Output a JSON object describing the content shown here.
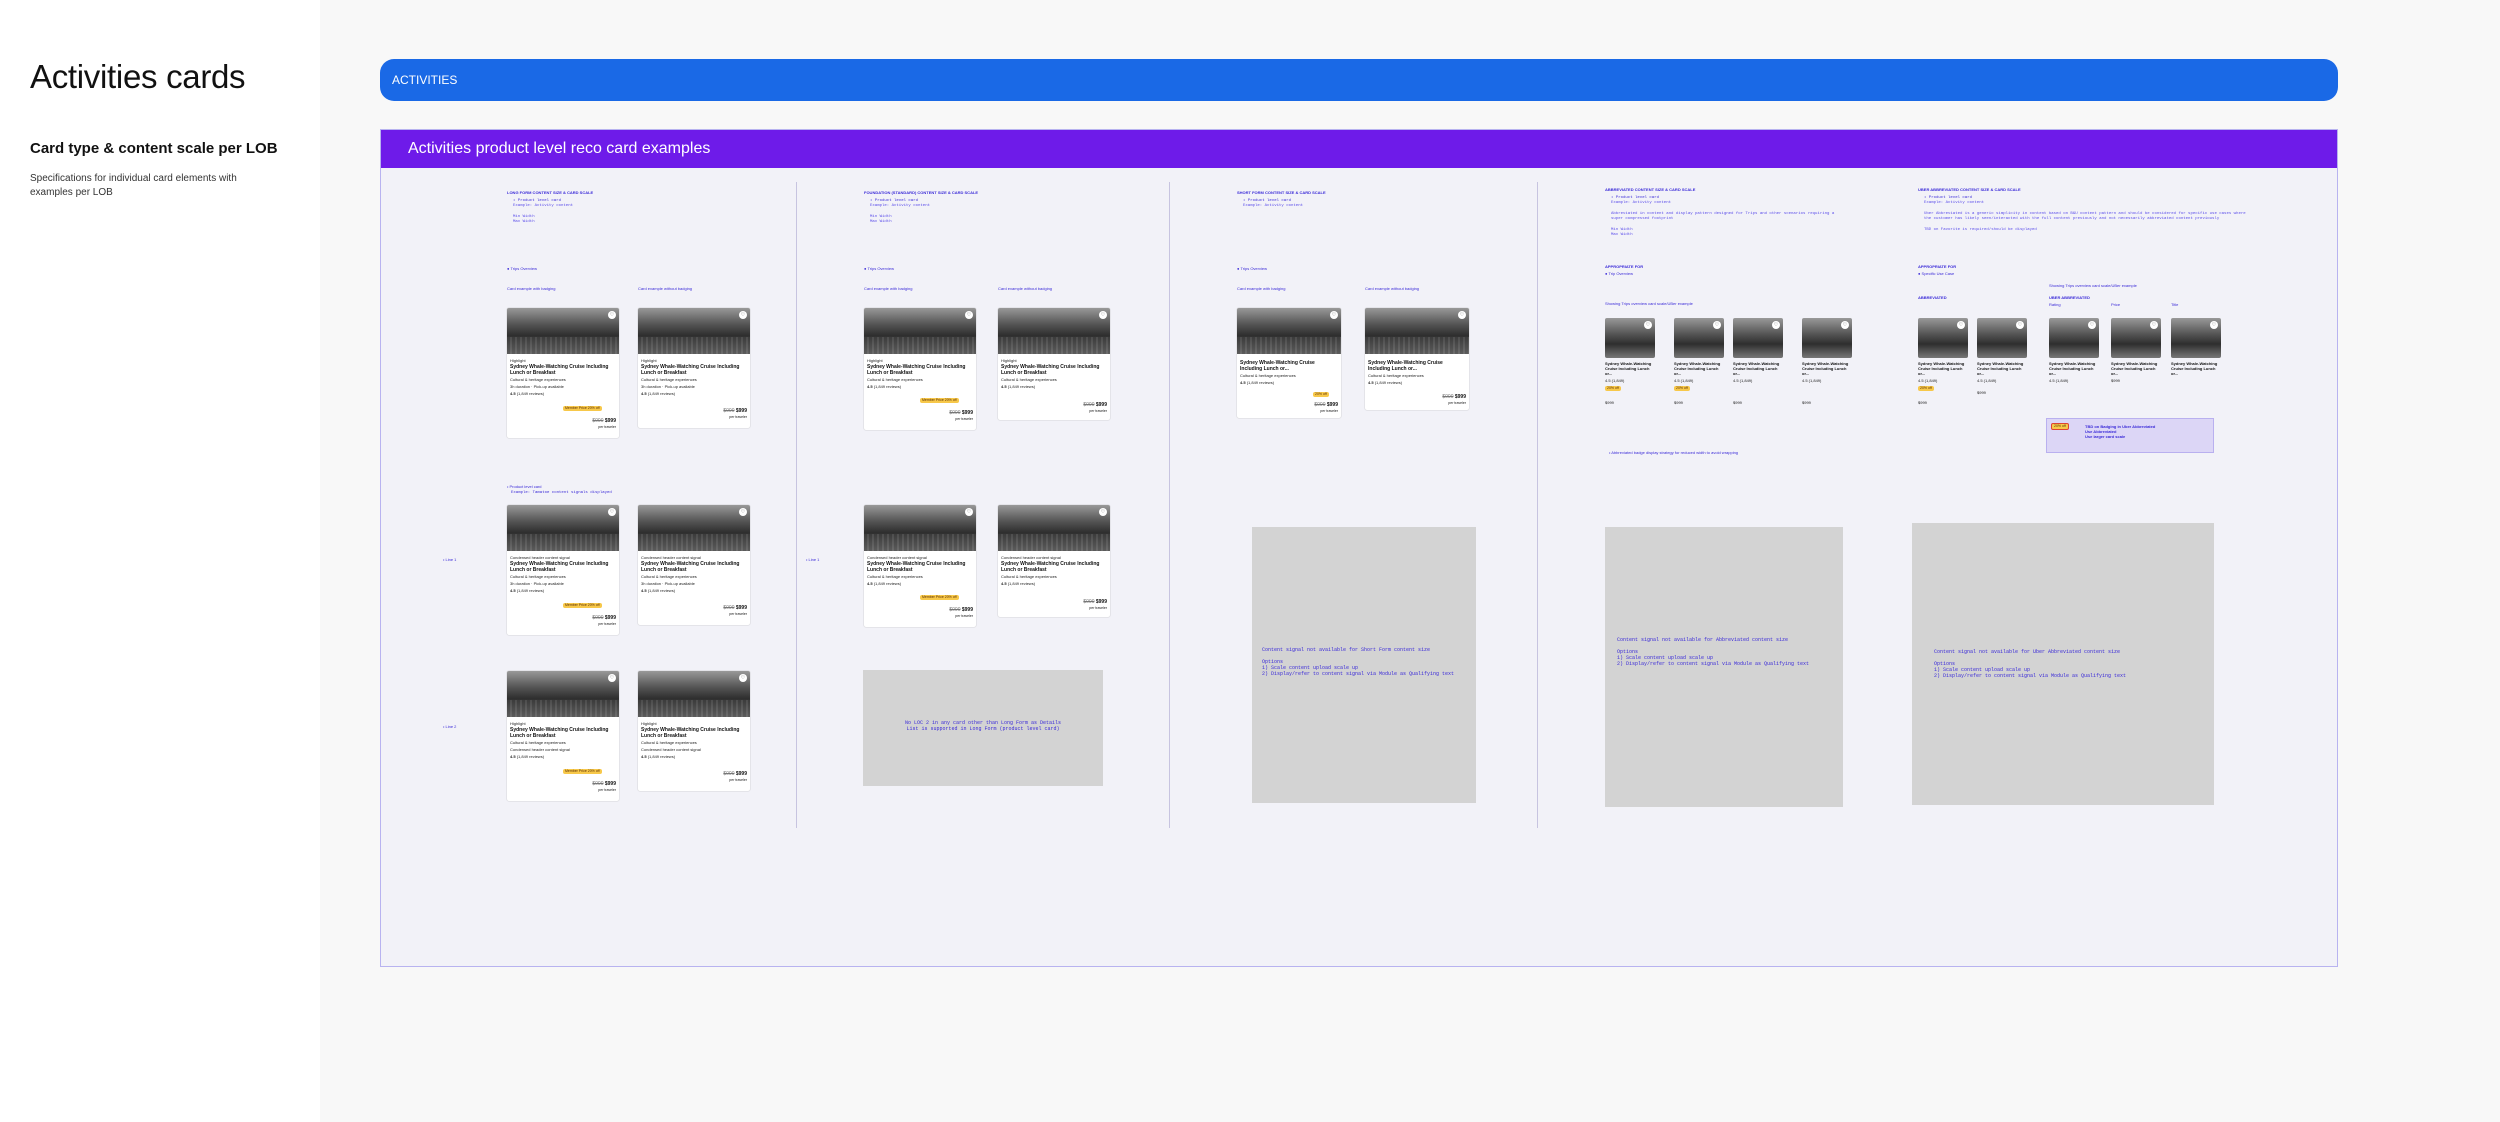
{
  "sidebar": {
    "title": "Activities cards",
    "subtitle": "Card type & content scale per LOB",
    "description": "Specifications for individual card elements with examples per LOB"
  },
  "banner": {
    "label": "ACTIVITIES"
  },
  "panel": {
    "title": "Activities  product level reco card examples"
  },
  "columns": [
    {
      "heading": "LONG FORM CONTENT SIZE & CARD SCALE",
      "bullet": "• Product level card",
      "example": "Example: Activity content",
      "min": "Min Width",
      "max": "Max Width"
    },
    {
      "heading": "FOUNDATION (STANDARD) CONTENT SIZE & CARD SCALE",
      "bullet": "• Product level card",
      "example": "Example: Activity content",
      "min": "Min Width",
      "max": "Max Width"
    },
    {
      "heading": "SHORT FORM CONTENT SIZE & CARD SCALE",
      "bullet": "• Product level card",
      "example": "Example: Activity content"
    },
    {
      "heading": "ABBREVIATED CONTENT SIZE & CARD SCALE",
      "bullet": "• Product level card",
      "example": "Example: Activity content",
      "min": "Min Width",
      "max": "Max Width"
    },
    {
      "heading": "UBER ABBREVIATED CONTENT SIZE & CARD SCALE",
      "bullet": "• Product level card",
      "example": "Example: Activity content"
    }
  ],
  "labels": {
    "trips_overview": "Trips Overview",
    "trip_overview": "Trip Overview",
    "with_badging": "Card example with badging",
    "without_badging": "Card example without badging",
    "appropriate_for": "APPROPRIATE FOR",
    "specific_use_case": "Specific Use Case",
    "abbrev_example": "Showing Trips overview card scale/UBer example",
    "abbrev_header": "ABBREVIATED",
    "uber_abbrev_header": "UBER ABBREVIATED",
    "uber_abbrev_example": "Showing Trips overview card scale/UBer example",
    "rating": "Rating",
    "price": "Price",
    "title": "Title",
    "abbrev_desc": "Abbreviated in content and display pattern designed for Trips and other scenarios requiring a super compressed footprint",
    "uber_desc": "Uber Abbreviated is a generic simplicity in content based on B&U content pattern and should be considered for specific use cases where the customer has likely seen/interacted with the full content previously and not necessarily abbreviated content previously",
    "uber_note": "TBD on Favorite is required/should be displayed",
    "abbrev_note": "• Abbreviated badge display strategy for reduced width to avoid wrapping",
    "product_lvl_long": "• Product level card",
    "product_lvl_long_ex": "Example: Tamatoe content signals displayed",
    "line1": "• Line 1",
    "line2": "• Line 2",
    "tbd_note": "TBD on Badging in Uber Abbreviated\nUse Abbreviated\nUse larger card scale"
  },
  "card": {
    "tag": "Highlight",
    "tag_line": "Condensed header content signal",
    "title": "Sydney Whale-Watching Cruise Including Lunch or Breakfast",
    "category": "Cultural & heritage experiences",
    "meta1": "3h duration",
    "meta2": "Pick-up available",
    "rating": "4.5",
    "reviews": "(1,849 reviews)",
    "badge": "Member Price 20% off",
    "badge_short": "20% off",
    "old_price": "$000",
    "price": "$999",
    "per": "per traveler",
    "mini_title": "Sydney Whale-Watching Cruise Including Lunch or...",
    "mini_rating": "4.5 (1,849)"
  },
  "gray_boxes": {
    "foundation": "No LOC 2 in any card other than Long Form as Details\nList is supported in Long Form (product level card)",
    "short": "Content signal not available for Short Form content size\n\nOptions\n1) Scale content upload scale up\n2) Display/refer to content signal via Module as Qualifying text",
    "abbrev": "Content signal not available for Abbreviated content size\n\nOptions\n1) Scale content upload scale up\n2) Display/refer to content signal via Module as Qualifying text",
    "uber": "Content signal not available for Uber Abbreviated content size\n\nOptions\n1) Scale content upload scale up\n2) Display/refer to content signal via Module as Qualifying text"
  },
  "colors": {
    "banner": "#1a69e6",
    "panel_head": "#6e1be9",
    "panel_bg": "#f2f2f8",
    "accent_text": "#3a2ad8",
    "badge": "#f7c84a"
  }
}
